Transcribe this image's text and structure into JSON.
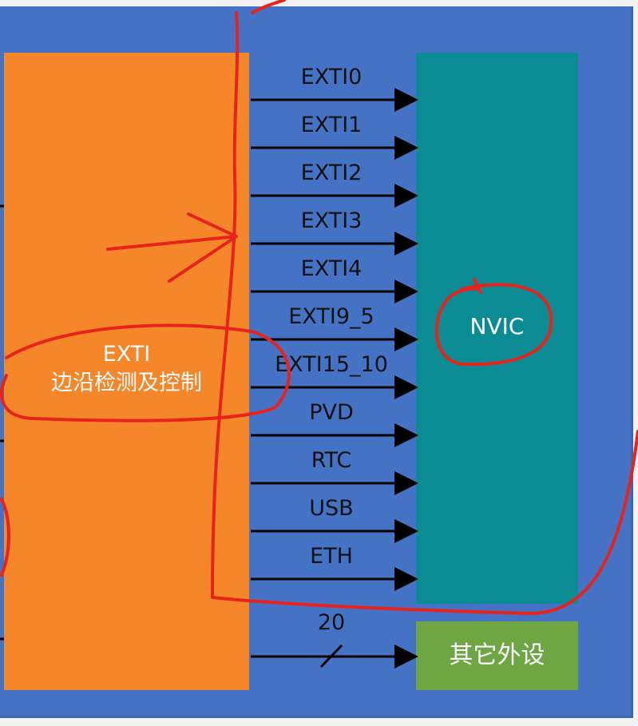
{
  "exti_block": {
    "title": "EXTI",
    "subtitle": "边沿检测及控制"
  },
  "nvic_block": {
    "label": "NVIC"
  },
  "other_peripherals": {
    "label": "其它外设",
    "bus_width": "20"
  },
  "signal_lines": [
    "EXTI0",
    "EXTI1",
    "EXTI2",
    "EXTI3",
    "EXTI4",
    "EXTI9_5",
    "EXTI15_10",
    "PVD",
    "RTC",
    "USB",
    "ETH"
  ],
  "colors": {
    "background_panel": "#4472c4",
    "exti_block": "#f5862a",
    "nvic_block": "#0b8c94",
    "other_block": "#6ea644",
    "annotation": "#e8231c",
    "arrow": "#000000"
  }
}
